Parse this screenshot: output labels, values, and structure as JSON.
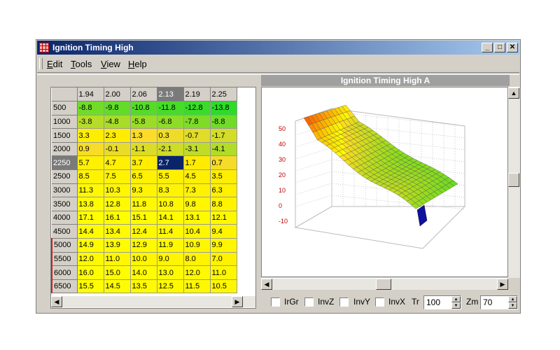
{
  "window": {
    "title": "Ignition Timing High",
    "controls": {
      "minimize": "_",
      "maximize": "□",
      "close": "✕"
    }
  },
  "menu": {
    "items": [
      {
        "label": "Edit",
        "hotkey": "E",
        "rest": "dit"
      },
      {
        "label": "Tools",
        "hotkey": "T",
        "rest": "ools"
      },
      {
        "label": "View",
        "hotkey": "V",
        "rest": "iew"
      },
      {
        "label": "Help",
        "hotkey": "H",
        "rest": "elp"
      }
    ]
  },
  "table": {
    "columns": [
      "1.94",
      "2.00",
      "2.06",
      "2.13",
      "2.19",
      "2.25"
    ],
    "selected_column": 3,
    "selected_row": 4,
    "rows": [
      {
        "label": "500",
        "values": [
          "-8.8",
          "-9.8",
          "-10.8",
          "-11.8",
          "-12.8",
          "-13.8"
        ]
      },
      {
        "label": "1000",
        "values": [
          "-3.8",
          "-4.8",
          "-5.8",
          "-6.8",
          "-7.8",
          "-8.8"
        ]
      },
      {
        "label": "1500",
        "values": [
          "3.3",
          "2.3",
          "1.3",
          "0.3",
          "-0.7",
          "-1.7"
        ]
      },
      {
        "label": "2000",
        "values": [
          "0.9",
          "-0.1",
          "-1.1",
          "-2.1",
          "-3.1",
          "-4.1"
        ]
      },
      {
        "label": "2250",
        "values": [
          "5.7",
          "4.7",
          "3.7",
          "2.7",
          "1.7",
          "0.7"
        ]
      },
      {
        "label": "2500",
        "values": [
          "8.5",
          "7.5",
          "6.5",
          "5.5",
          "4.5",
          "3.5"
        ]
      },
      {
        "label": "3000",
        "values": [
          "11.3",
          "10.3",
          "9.3",
          "8.3",
          "7.3",
          "6.3"
        ]
      },
      {
        "label": "3500",
        "values": [
          "13.8",
          "12.8",
          "11.8",
          "10.8",
          "9.8",
          "8.8"
        ]
      },
      {
        "label": "4000",
        "values": [
          "17.1",
          "16.1",
          "15.1",
          "14.1",
          "13.1",
          "12.1"
        ]
      },
      {
        "label": "4500",
        "values": [
          "14.4",
          "13.4",
          "12.4",
          "11.4",
          "10.4",
          "9.4"
        ]
      },
      {
        "label": "5000",
        "values": [
          "14.9",
          "13.9",
          "12.9",
          "11.9",
          "10.9",
          "9.9"
        ]
      },
      {
        "label": "5500",
        "values": [
          "12.0",
          "11.0",
          "10.0",
          "9.0",
          "8.0",
          "7.0"
        ]
      },
      {
        "label": "6000",
        "values": [
          "16.0",
          "15.0",
          "14.0",
          "13.0",
          "12.0",
          "11.0"
        ]
      },
      {
        "label": "6500",
        "values": [
          "15.5",
          "14.5",
          "13.5",
          "12.5",
          "11.5",
          "10.5"
        ]
      }
    ]
  },
  "plot": {
    "title": "Ignition Timing High A",
    "z_ticks": [
      "50",
      "40",
      "30",
      "20",
      "10",
      "0",
      "-10"
    ]
  },
  "options": {
    "irgr": "IrGr",
    "invz": "InvZ",
    "invy": "InvY",
    "invx": "InvX",
    "tr_label": "Tr",
    "tr_value": "100",
    "zm_label": "Zm",
    "zm_value": "70"
  },
  "colors": {
    "titlebar_start": "#0a246a",
    "titlebar_end": "#a6caf0",
    "selection": "#0a246a",
    "low": "#20d020",
    "high": "#ffff00"
  }
}
